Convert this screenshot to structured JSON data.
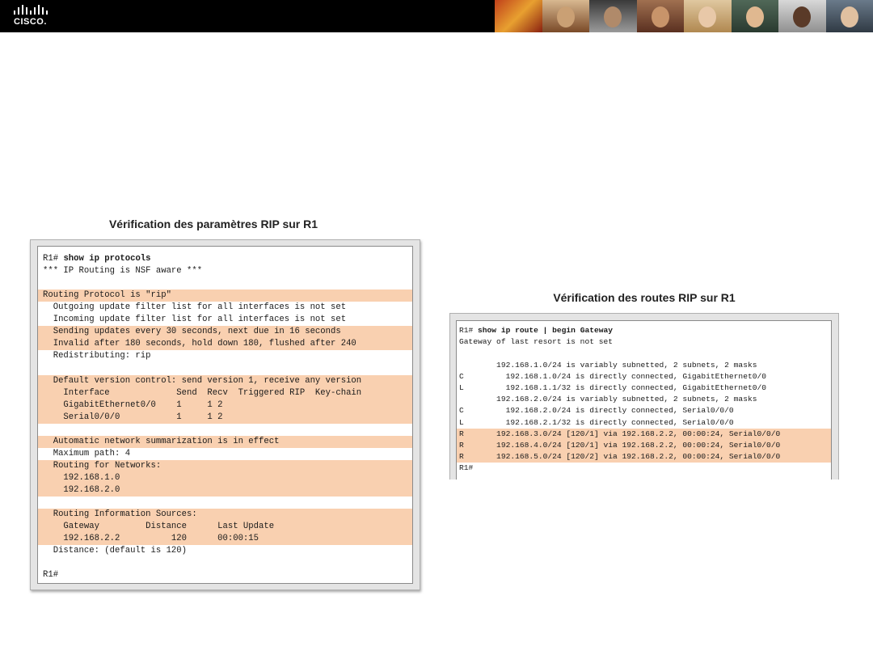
{
  "brand": {
    "logo_text": "CISCO."
  },
  "panel1": {
    "title": "Vérification des paramètres RIP sur R1",
    "highlight_color": "#f9d0b0",
    "lines": [
      {
        "prefix": "R1# ",
        "cmd": "show ip protocols",
        "hl": false
      },
      {
        "text": "*** IP Routing is NSF aware ***",
        "hl": false
      },
      {
        "text": "",
        "hl": false
      },
      {
        "text": "Routing Protocol is \"rip\"",
        "hl": true
      },
      {
        "text": "  Outgoing update filter list for all interfaces is not set",
        "hl": false
      },
      {
        "text": "  Incoming update filter list for all interfaces is not set",
        "hl": false
      },
      {
        "text": "  Sending updates every 30 seconds, next due in 16 seconds",
        "hl": true
      },
      {
        "text": "  Invalid after 180 seconds, hold down 180, flushed after 240",
        "hl": true
      },
      {
        "text": "  Redistributing: rip",
        "hl": false
      },
      {
        "text": "",
        "hl": false
      },
      {
        "text": "  Default version control: send version 1, receive any version",
        "hl": true
      },
      {
        "text": "    Interface             Send  Recv  Triggered RIP  Key-chain",
        "hl": true
      },
      {
        "text": "    GigabitEthernet0/0    1     1 2",
        "hl": true
      },
      {
        "text": "    Serial0/0/0           1     1 2",
        "hl": true
      },
      {
        "text": "",
        "hl": false
      },
      {
        "text": "  Automatic network summarization is in effect",
        "hl": true
      },
      {
        "text": "  Maximum path: 4",
        "hl": false
      },
      {
        "text": "  Routing for Networks:",
        "hl": true
      },
      {
        "text": "    192.168.1.0",
        "hl": true
      },
      {
        "text": "    192.168.2.0",
        "hl": true
      },
      {
        "text": "",
        "hl": false
      },
      {
        "text": "  Routing Information Sources:",
        "hl": true
      },
      {
        "text": "    Gateway         Distance      Last Update",
        "hl": true
      },
      {
        "text": "    192.168.2.2          120      00:00:15",
        "hl": true
      },
      {
        "text": "  Distance: (default is 120)",
        "hl": false
      },
      {
        "text": "",
        "hl": false
      },
      {
        "text": "R1#",
        "hl": false
      }
    ]
  },
  "panel2": {
    "title": "Vérification des routes RIP sur R1",
    "lines": [
      {
        "prefix": "R1# ",
        "cmd": "show ip route | begin Gateway",
        "hl": false
      },
      {
        "text": "Gateway of last resort is not set",
        "hl": false
      },
      {
        "text": "",
        "hl": false
      },
      {
        "text": "        192.168.1.0/24 is variably subnetted, 2 subnets, 2 masks",
        "hl": false
      },
      {
        "text": "C         192.168.1.0/24 is directly connected, GigabitEthernet0/0",
        "hl": false
      },
      {
        "text": "L         192.168.1.1/32 is directly connected, GigabitEthernet0/0",
        "hl": false
      },
      {
        "text": "        192.168.2.0/24 is variably subnetted, 2 subnets, 2 masks",
        "hl": false
      },
      {
        "text": "C         192.168.2.0/24 is directly connected, Serial0/0/0",
        "hl": false
      },
      {
        "text": "L         192.168.2.1/32 is directly connected, Serial0/0/0",
        "hl": false
      },
      {
        "text": "R       192.168.3.0/24 [120/1] via 192.168.2.2, 00:00:24, Serial0/0/0",
        "hl": true
      },
      {
        "text": "R       192.168.4.0/24 [120/1] via 192.168.2.2, 00:00:24, Serial0/0/0",
        "hl": true
      },
      {
        "text": "R       192.168.5.0/24 [120/2] via 192.168.2.2, 00:00:24, Serial0/0/0",
        "hl": true
      },
      {
        "text": "R1#",
        "hl": false
      }
    ]
  }
}
